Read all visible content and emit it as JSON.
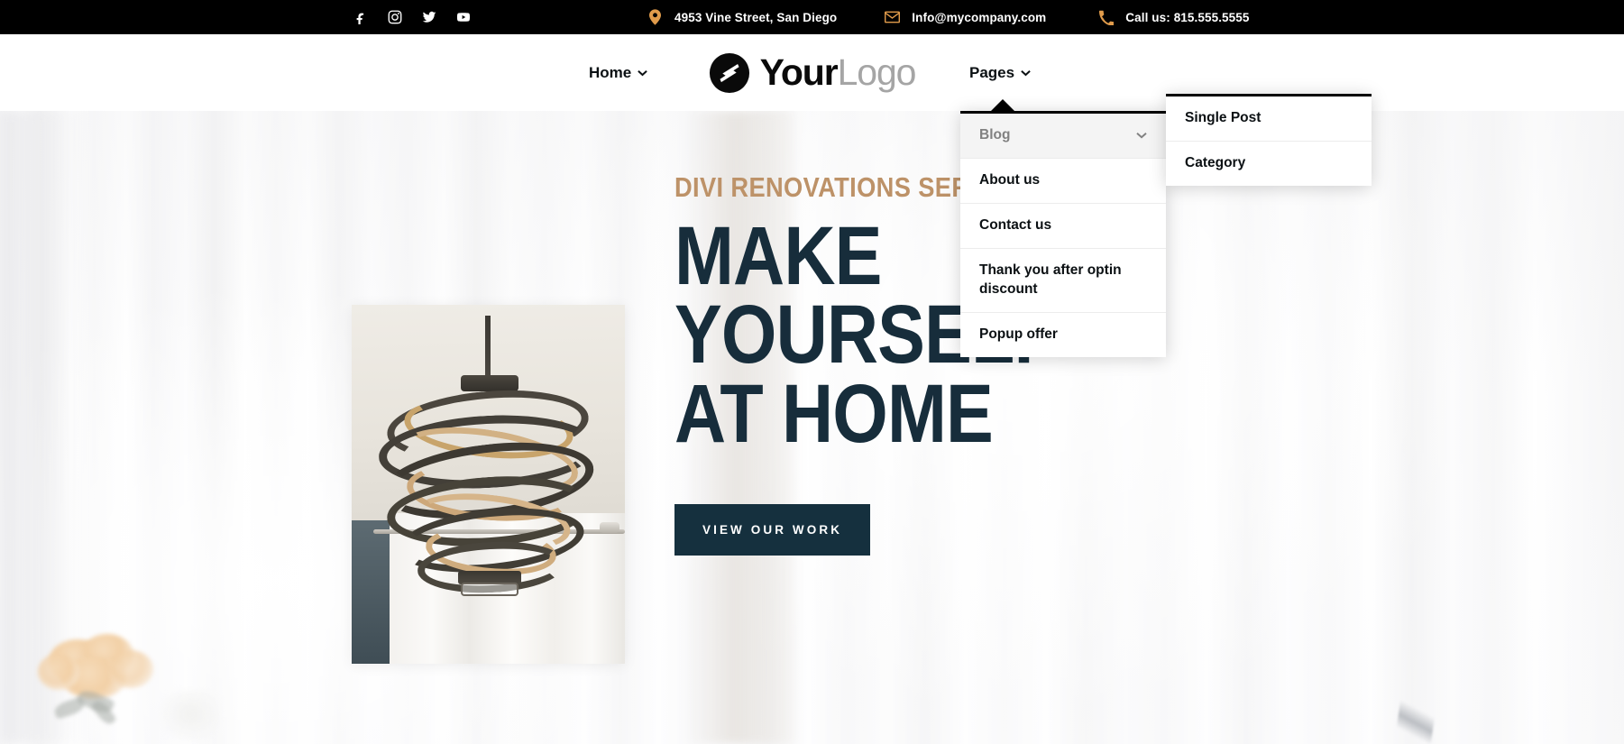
{
  "topbar": {
    "social": [
      {
        "name": "facebook-icon",
        "label": "Facebook"
      },
      {
        "name": "instagram-icon",
        "label": "Instagram"
      },
      {
        "name": "twitter-icon",
        "label": "Twitter"
      },
      {
        "name": "youtube-icon",
        "label": "YouTube"
      }
    ],
    "address": "4953 Vine Street, San Diego",
    "email": "Info@mycompany.com",
    "phone": "Call us: 815.555.5555",
    "background": "#000000",
    "icon_color": "#e09b4b",
    "text_color": "#ffffff"
  },
  "header": {
    "nav_left": "Home",
    "nav_right": "Pages",
    "logo": {
      "primary": "Your",
      "secondary": "Logo"
    },
    "background": "#ffffff"
  },
  "dropdown": {
    "items": [
      {
        "label": "Blog",
        "active": true,
        "has_submenu": true
      },
      {
        "label": "About us",
        "active": false,
        "has_submenu": false
      },
      {
        "label": "Contact us",
        "active": false,
        "has_submenu": false
      },
      {
        "label": "Thank you after optin discount",
        "active": false,
        "has_submenu": false
      },
      {
        "label": "Popup offer",
        "active": false,
        "has_submenu": false
      }
    ]
  },
  "submenu": {
    "items": [
      {
        "label": "Single Post"
      },
      {
        "label": "Category"
      }
    ]
  },
  "hero": {
    "eyebrow": "DIVI RENOVATIONS SERVICE",
    "headline_line1": "MAKE YOURSELF",
    "headline_line2": "AT HOME",
    "cta_label": "VIEW OUR WORK",
    "eyebrow_color": "#bd9268",
    "headline_color": "#172d3b",
    "cta_background": "#15303e",
    "image_alt": "Modern spiral chandelier hanging in a bright room with white curtains"
  }
}
